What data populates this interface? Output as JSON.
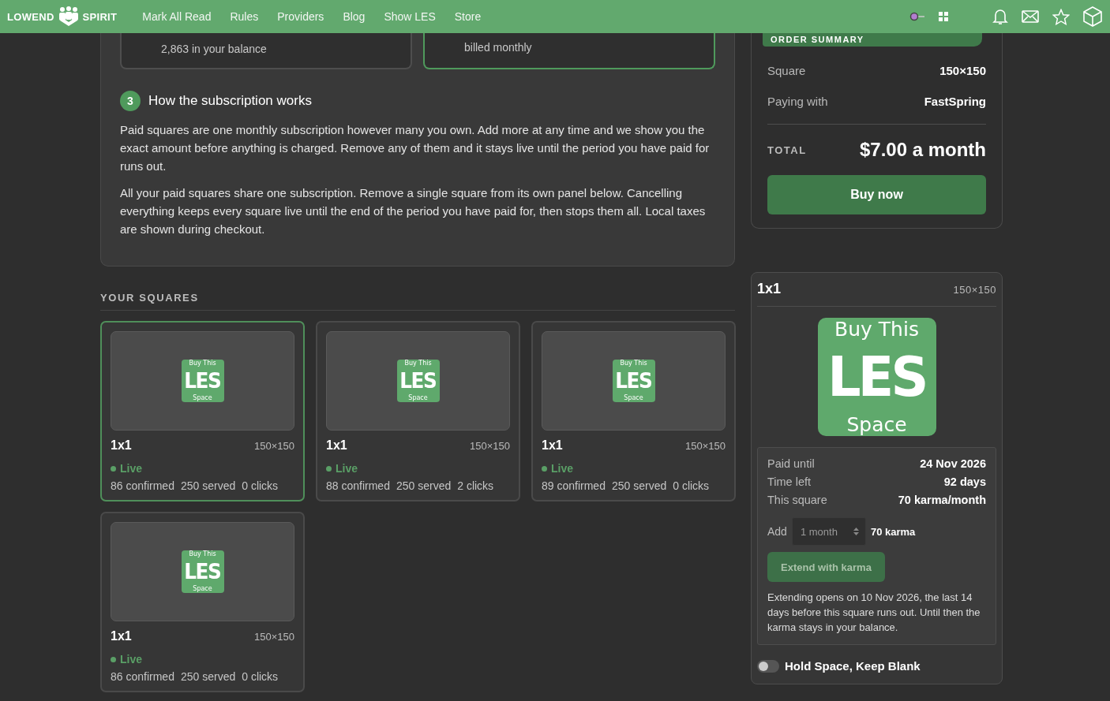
{
  "header": {
    "brand_left": "LOWEND",
    "brand_right": "SPIRIT",
    "nav": [
      "Mark All Read",
      "Rules",
      "Providers",
      "Blog",
      "Show LES",
      "Store"
    ]
  },
  "payment_options": [
    {
      "text": "2,863 in your balance",
      "selected": false
    },
    {
      "text": "billed monthly",
      "selected": true
    }
  ],
  "how_it_works": {
    "step": "3",
    "title": "How the subscription works",
    "paragraphs": [
      "Paid squares are one monthly subscription however many you own. Add more at any time and we show you the exact amount before anything is charged. Remove any of them and it stays live until the period you have paid for runs out.",
      "All your paid squares share one subscription. Remove a single square from its own panel below. Cancelling everything keeps every square live until the end of the period you have paid for, then stops them all. Local taxes are shown during checkout."
    ]
  },
  "squares_heading": "YOUR SQUARES",
  "squares": [
    {
      "name": "1x1",
      "size": "150×150",
      "status": "Live",
      "live": true,
      "selected": true,
      "stats": [
        "86 confirmed",
        "250 served",
        "0 clicks"
      ],
      "ad": {
        "top": "Buy This",
        "main": "LES",
        "bottom": "Space"
      }
    },
    {
      "name": "1x1",
      "size": "150×150",
      "status": "Live",
      "live": true,
      "selected": false,
      "stats": [
        "88 confirmed",
        "250 served",
        "2 clicks"
      ],
      "ad": {
        "top": "Buy This",
        "main": "LES",
        "bottom": "Space"
      }
    },
    {
      "name": "1x1",
      "size": "150×150",
      "status": "Live",
      "live": true,
      "selected": false,
      "stats": [
        "89 confirmed",
        "250 served",
        "0 clicks"
      ],
      "ad": {
        "top": "Buy This",
        "main": "LES",
        "bottom": "Space"
      }
    },
    {
      "name": "1x1",
      "size": "150×150",
      "status": "Live",
      "live": true,
      "selected": false,
      "stats": [
        "86 confirmed",
        "250 served",
        "0 clicks"
      ],
      "ad": {
        "top": "Buy This",
        "main": "LES",
        "bottom": "Space"
      }
    }
  ],
  "order_summary": {
    "title": "ORDER SUMMARY",
    "rows": [
      {
        "label": "Square",
        "value": "150×150"
      },
      {
        "label": "Paying with",
        "value": "FastSpring"
      }
    ],
    "total_label": "TOTAL",
    "total": "$7.00 a month",
    "button": "Buy now"
  },
  "square_detail": {
    "name": "1x1",
    "size": "150×150",
    "ad": {
      "top": "Buy This",
      "main": "LES",
      "bottom": "Space"
    },
    "rows": [
      {
        "label": "Paid until",
        "value": "24 Nov 2026"
      },
      {
        "label": "Time left",
        "value": "92 days"
      },
      {
        "label": "This square",
        "value": "70 karma/month"
      }
    ],
    "add_label": "Add",
    "duration": "1 month",
    "add_cost": "70 karma",
    "extend_button": {
      "label": "Extend with karma",
      "disabled": true
    },
    "note": "Extending opens on 10 Nov 2026, the last 14 days before this square runs out. Until then the karma stays in your balance.",
    "toggle": {
      "label": "Hold Space, Keep Blank",
      "on": false
    }
  }
}
